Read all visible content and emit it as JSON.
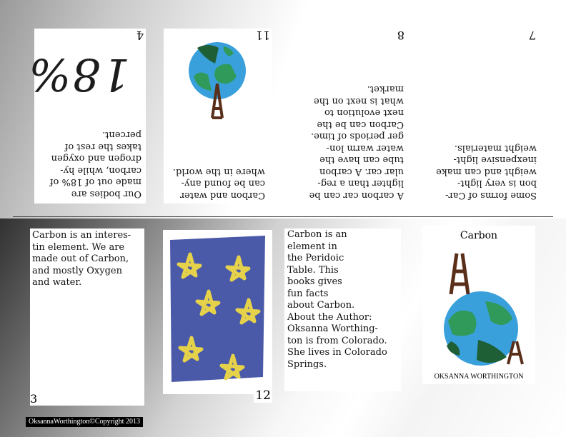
{
  "booklet": {
    "copyright": "OksannaWorthington©Copyright 2013",
    "pages": {
      "p4": {
        "number": "4",
        "lines": [
          "Our bodies are",
          "made out of 18% of",
          "carbon, while hy-",
          "drogen and oxygen",
          "takes the rest of",
          "percent."
        ],
        "big_text": "18%"
      },
      "p11": {
        "number": "11",
        "lines": [
          "Carbon and water",
          "can be found any-",
          "where in the world."
        ]
      },
      "p8": {
        "number": "8",
        "lines": [
          "A carbon car can be",
          "lighter than a reg-",
          "ular car.  A carbon",
          "tube can have the",
          "water warm lon-",
          "ger periods of time.",
          "Carbon can be the",
          "next evolution to",
          "what is next on the",
          "market."
        ]
      },
      "p7": {
        "number": "7",
        "lines": [
          "Some forms of Car-",
          "bon is very light-",
          "weight and can make",
          "inexpensive light-",
          "weight materials."
        ]
      },
      "p3": {
        "number": "3",
        "lines": [
          "Carbon is an interes-",
          "tin element.  We are",
          "made out of Carbon,",
          "and mostly Oxygen",
          "and water."
        ]
      },
      "p12": {
        "number": "12"
      },
      "p1": {
        "lines": [
          "Carbon is an",
          "element in",
          "the Peridoic",
          "Table.  This",
          "books gives",
          "fun facts",
          "about Carbon.",
          "About the Author:",
          "Oksanna Worthing-",
          "ton is from Colorado.",
          "She lives in Colorado",
          "Springs."
        ]
      },
      "cover": {
        "title": "Carbon",
        "author": "OKSANNA WORTHINGTON"
      }
    }
  },
  "colors": {
    "ocean": "#3aa0dc",
    "land": "#2f9a5a",
    "dark_land": "#1f5f36",
    "tower": "#5a2f1a",
    "star_bg": "#4a5aa8",
    "star": "#e6d24a"
  }
}
